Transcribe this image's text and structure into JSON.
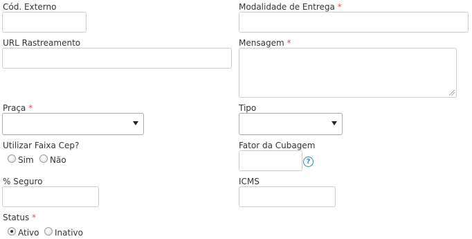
{
  "fields": {
    "cod_externo": {
      "label": "Cód. Externo",
      "value": ""
    },
    "modalidade_entrega": {
      "label": "Modalidade de Entrega",
      "required_mark": "*",
      "value": ""
    },
    "url_rastreamento": {
      "label": "URL Rastreamento",
      "value": ""
    },
    "mensagem": {
      "label": "Mensagem",
      "required_mark": "*",
      "value": ""
    },
    "praca": {
      "label": "Praça",
      "required_mark": "*",
      "selected": ""
    },
    "tipo": {
      "label": "Tipo",
      "selected": ""
    },
    "utilizar_faixa_cep": {
      "label": "Utilizar Faixa Cep?",
      "options": [
        {
          "label": "Sim",
          "checked": false
        },
        {
          "label": "Não",
          "checked": false
        }
      ]
    },
    "fator_cubagem": {
      "label": "Fator da Cubagem",
      "value": "",
      "help_icon": "?"
    },
    "seguro": {
      "label": "% Seguro",
      "value": ""
    },
    "icms": {
      "label": "ICMS",
      "value": ""
    },
    "status": {
      "label": "Status",
      "required_mark": "*",
      "options": [
        {
          "label": "Ativo",
          "checked": true
        },
        {
          "label": "Inativo",
          "checked": false
        }
      ]
    }
  },
  "colors": {
    "required": "#d9534f",
    "help_icon": "#2a8ab8",
    "input_border": "#cccccc"
  }
}
